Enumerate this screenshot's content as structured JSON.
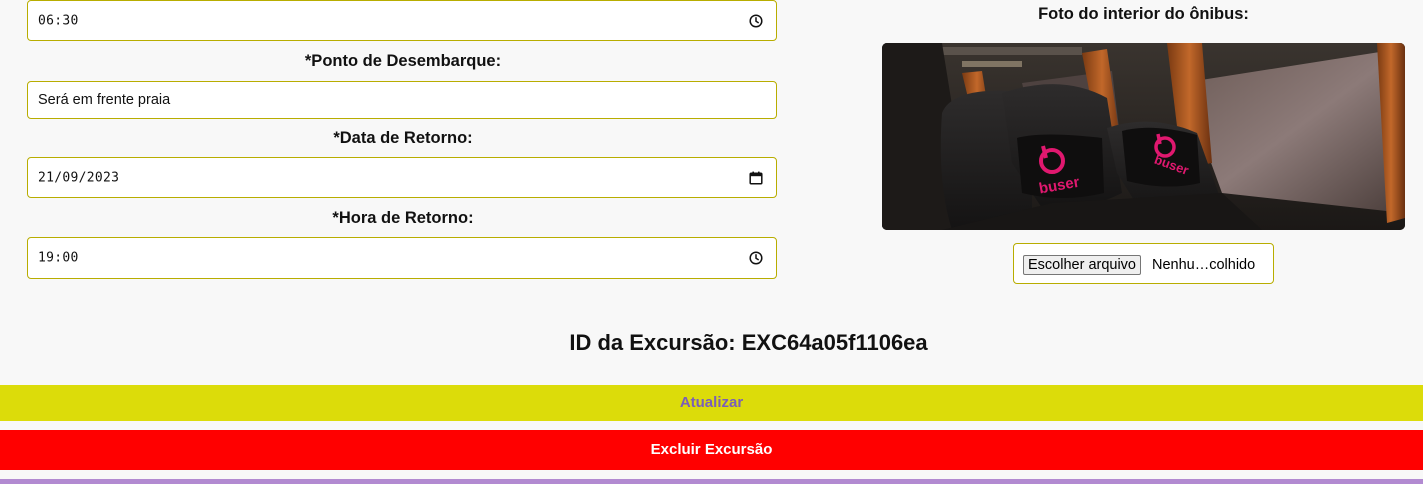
{
  "form": {
    "departure_time": {
      "value": "06:30"
    },
    "dropoff_point": {
      "label": "*Ponto de Desembarque:",
      "value": "Será em frente praia"
    },
    "return_date": {
      "label": "*Data de Retorno:",
      "value": "21/09/2023"
    },
    "return_time": {
      "label": "*Hora de Retorno:",
      "value": "19:00"
    }
  },
  "photo": {
    "title": "Foto do interior do ônibus:",
    "seat_brand": "buser",
    "file_button_label": "Escolher arquivo",
    "file_status": "Nenhu…colhido"
  },
  "excursion": {
    "id_text": "ID da Excursão: EXC64a05f1106ea"
  },
  "actions": {
    "update_label": "Atualizar",
    "delete_label": "Excluir Excursão"
  },
  "colors": {
    "field_border": "#b8ad00",
    "update_bg": "#dcdc0a",
    "update_text": "#7a5fb8",
    "delete_bg": "#ff0000",
    "bottom_strip": "#b28ad1",
    "brand_pink": "#e0186f"
  },
  "icons": {
    "time": "clock-icon",
    "date": "calendar-icon"
  }
}
